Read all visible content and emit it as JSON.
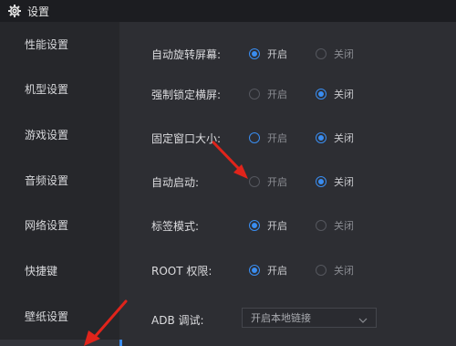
{
  "window": {
    "title": "设置",
    "icon": "gear-icon"
  },
  "colors": {
    "accent": "#3a8df0",
    "arrow": "#e0241b",
    "background": "#2d2e33",
    "sidebar": "#26272b"
  },
  "sidebar": {
    "items": [
      {
        "label": "性能设置"
      },
      {
        "label": "机型设置"
      },
      {
        "label": "游戏设置"
      },
      {
        "label": "音频设置"
      },
      {
        "label": "网络设置"
      },
      {
        "label": "快捷键"
      },
      {
        "label": "壁纸设置"
      }
    ]
  },
  "settings": {
    "auto_rotate": {
      "label": "自动旋转屏幕:",
      "on": "开启",
      "off": "关闭",
      "selected": "on"
    },
    "force_landscape": {
      "label": "强制锁定横屏:",
      "on": "开启",
      "off": "关闭",
      "selected": "off"
    },
    "fixed_window": {
      "label": "固定窗口大小:",
      "on": "开启",
      "off": "关闭",
      "selected": "off"
    },
    "auto_start": {
      "label": "自动启动:",
      "on": "开启",
      "off": "关闭",
      "selected": "off"
    },
    "tab_mode": {
      "label": "标签模式:",
      "on": "开启",
      "off": "关闭",
      "selected": "on"
    },
    "root": {
      "label": "ROOT 权限:",
      "on": "开启",
      "off": "关闭",
      "selected": "on"
    },
    "adb": {
      "label": "ADB 调试:",
      "value": "开启本地链接"
    }
  }
}
